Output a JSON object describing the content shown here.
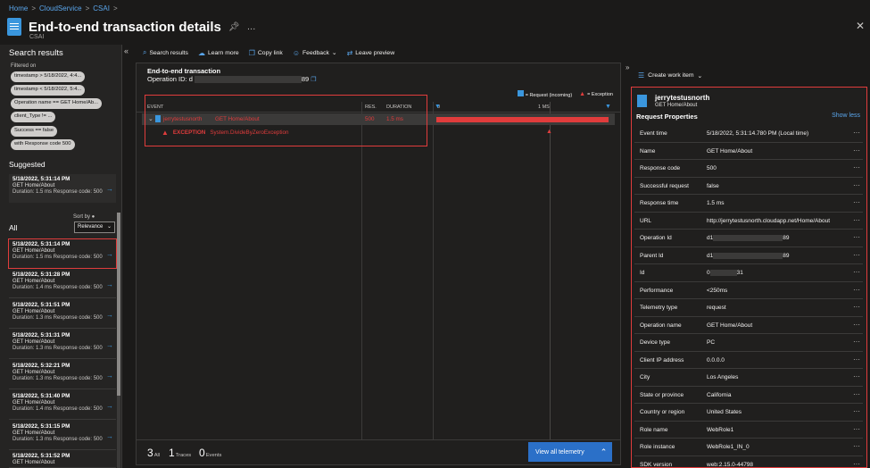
{
  "breadcrumb": [
    "Home",
    "CloudService",
    "CSAI"
  ],
  "page": {
    "title": "End-to-end transaction details",
    "subtitle": "CSAI"
  },
  "left": {
    "title": "Search results",
    "filtered_on": "Filtered on",
    "chips": [
      "timestamp > 5/18/2022, 4:4...",
      "timestamp < 5/18/2022, 5:4...",
      "Operation name == GET Home/Ab...",
      "client_Type != ...",
      "Success == false",
      "with Response code 500"
    ],
    "suggested_label": "Suggested",
    "suggested": {
      "time": "5/18/2022, 5:31:14 PM",
      "name": "GET Home/About",
      "detail": "Duration: 1.5 ms  Response code: 500"
    },
    "all_label": "All",
    "sort_label": "Sort by",
    "sort_value": "Relevance",
    "results": [
      {
        "time": "5/18/2022, 5:31:14 PM",
        "name": "GET Home/About",
        "detail": "Duration: 1.5 ms  Response code: 500"
      },
      {
        "time": "5/18/2022, 5:31:28 PM",
        "name": "GET Home/About",
        "detail": "Duration: 1.4 ms  Response code: 500"
      },
      {
        "time": "5/18/2022, 5:31:51 PM",
        "name": "GET Home/About",
        "detail": "Duration: 1.3 ms  Response code: 500"
      },
      {
        "time": "5/18/2022, 5:31:31 PM",
        "name": "GET Home/About",
        "detail": "Duration: 1.3 ms  Response code: 500"
      },
      {
        "time": "5/18/2022, 5:32:21 PM",
        "name": "GET Home/About",
        "detail": "Duration: 1.3 ms  Response code: 500"
      },
      {
        "time": "5/18/2022, 5:31:40 PM",
        "name": "GET Home/About",
        "detail": "Duration: 1.4 ms  Response code: 500"
      },
      {
        "time": "5/18/2022, 5:31:15 PM",
        "name": "GET Home/About",
        "detail": "Duration: 1.3 ms  Response code: 500"
      },
      {
        "time": "5/18/2022, 5:31:52 PM",
        "name": "GET Home/About",
        "detail": ""
      }
    ]
  },
  "toolbar": [
    "Search results",
    "Learn more",
    "Copy link",
    "Feedback",
    "Leave preview"
  ],
  "middle": {
    "title": "End-to-end transaction",
    "operation_label": "Operation ID: d",
    "operation_tail": "89",
    "legend_request": "= Request (incoming)",
    "legend_exception": "= Exception",
    "col_event": "EVENT",
    "col_res": "RES.",
    "col_duration": "DURATION",
    "tick_0": "0",
    "tick_1": "1 MS",
    "row": {
      "name": "jerrytestusnorth",
      "operation": "GET Home/About",
      "res": "500",
      "duration": "1.5 ms"
    },
    "exception": {
      "label": "EXCEPTION",
      "type": "System.DivideByZeroException"
    },
    "footer": {
      "all_count": "3",
      "all_label": "All",
      "traces_count": "1",
      "traces_label": "Traces",
      "events_count": "0",
      "events_label": "Events",
      "view_all": "View all telemetry"
    }
  },
  "right": {
    "create_work_item": "Create work item",
    "name": "jerrytestusnorth",
    "operation": "GET Home/About",
    "section_title": "Request Properties",
    "show_less": "Show less",
    "props": [
      {
        "k": "Event time",
        "v": "5/18/2022, 5:31:14.780 PM (Local time)"
      },
      {
        "k": "Name",
        "v": "GET Home/About"
      },
      {
        "k": "Response code",
        "v": "500"
      },
      {
        "k": "Successful request",
        "v": "false"
      },
      {
        "k": "Response time",
        "v": "1.5 ms"
      },
      {
        "k": "URL",
        "v": "http://jerrytestusnorth.cloudapp.net/Home/About"
      },
      {
        "k": "Operation Id",
        "v": "d1",
        "tail": "89"
      },
      {
        "k": "Parent Id",
        "v": "d1",
        "tail": "89"
      },
      {
        "k": "Id",
        "v": "0",
        "tail": "31"
      },
      {
        "k": "Performance",
        "v": "<250ms"
      },
      {
        "k": "Telemetry type",
        "v": "request"
      },
      {
        "k": "Operation name",
        "v": "GET Home/About"
      },
      {
        "k": "Device type",
        "v": "PC"
      },
      {
        "k": "Client IP address",
        "v": "0.0.0.0"
      },
      {
        "k": "City",
        "v": "Los Angeles"
      },
      {
        "k": "State or province",
        "v": "California"
      },
      {
        "k": "Country or region",
        "v": "United States"
      },
      {
        "k": "Role name",
        "v": "WebRole1"
      },
      {
        "k": "Role instance",
        "v": "WebRole1_IN_0"
      },
      {
        "k": "SDK version",
        "v": "web:2.15.0-44798"
      }
    ]
  },
  "colors": {
    "accent": "#3a96dd",
    "error": "#e03c3c",
    "background": "#1b1a19"
  }
}
